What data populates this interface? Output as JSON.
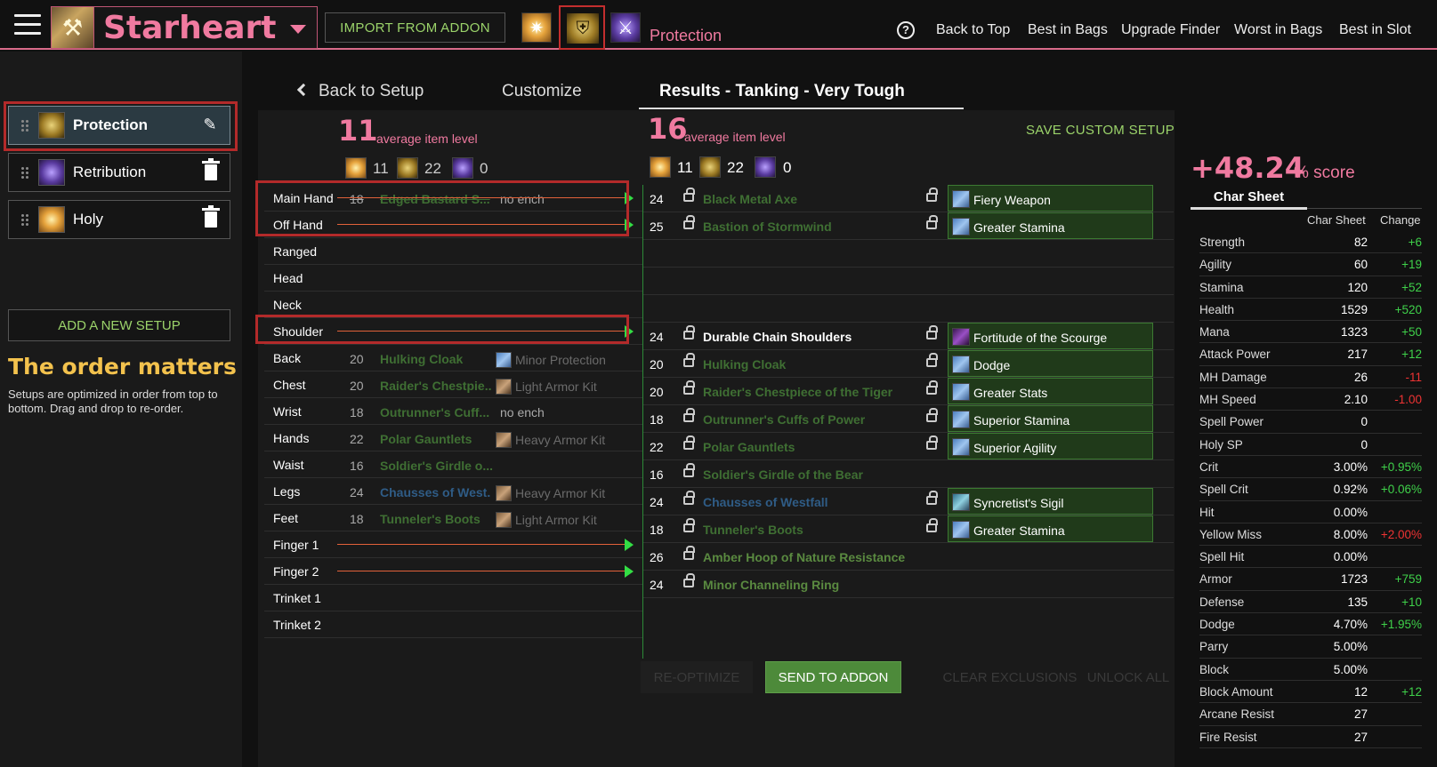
{
  "header": {
    "character_name": "Starheart",
    "import_label": "IMPORT FROM ADDON",
    "spec_label": "Protection",
    "help_glyph": "?",
    "links": [
      "Back to Top",
      "Best in Bags",
      "Upgrade Finder",
      "Worst in Bags",
      "Best in Slot"
    ]
  },
  "sidebar": {
    "setups": [
      {
        "label": "Protection",
        "icon": "protection-icon",
        "action": "edit"
      },
      {
        "label": "Retribution",
        "icon": "retribution-icon",
        "action": "delete"
      },
      {
        "label": "Holy",
        "icon": "holy-icon",
        "action": "delete"
      }
    ],
    "add_label": "ADD A NEW SETUP",
    "order_title": "The order matters",
    "order_text": "Setups are optimized in order from top to bottom. Drag and drop to re-order."
  },
  "tabs": {
    "back": "Back to Setup",
    "customize": "Customize",
    "results": "Results - Tanking - Very Tough"
  },
  "left": {
    "avg_ilvl": "11",
    "avg_label": "average item level",
    "spec_levels": [
      "11",
      "22",
      "0"
    ]
  },
  "right": {
    "avg_ilvl": "16",
    "avg_label": "average item level",
    "spec_levels": [
      "11",
      "22",
      "0"
    ],
    "save_label": "SAVE CUSTOM SETUP"
  },
  "left_rows": [
    {
      "slot": "Main Hand",
      "lvl": "18",
      "item": "Edged Bastard S...",
      "ench": "no ench",
      "arrow": true
    },
    {
      "slot": "Off Hand",
      "lvl": "",
      "item": "",
      "ench": "",
      "arrow": true
    },
    {
      "slot": "Ranged",
      "lvl": "",
      "item": "",
      "ench": ""
    },
    {
      "slot": "Head",
      "lvl": "",
      "item": "",
      "ench": ""
    },
    {
      "slot": "Neck",
      "lvl": "",
      "item": "",
      "ench": ""
    },
    {
      "slot": "Shoulder",
      "lvl": "",
      "item": "",
      "ench": "",
      "arrow": true
    },
    {
      "slot": "Back",
      "lvl": "20",
      "item": "Hulking Cloak",
      "ench": "Minor Protection"
    },
    {
      "slot": "Chest",
      "lvl": "20",
      "item": "Raider's Chestpie...",
      "ench": "Light Armor Kit"
    },
    {
      "slot": "Wrist",
      "lvl": "18",
      "item": "Outrunner's Cuff...",
      "ench": "no ench"
    },
    {
      "slot": "Hands",
      "lvl": "22",
      "item": "Polar Gauntlets",
      "ench": "Heavy Armor Kit"
    },
    {
      "slot": "Waist",
      "lvl": "16",
      "item": "Soldier's Girdle o...",
      "ench": ""
    },
    {
      "slot": "Legs",
      "lvl": "24",
      "item": "Chausses of West...",
      "ench": "Heavy Armor Kit"
    },
    {
      "slot": "Feet",
      "lvl": "18",
      "item": "Tunneler's Boots",
      "ench": "Light Armor Kit"
    },
    {
      "slot": "Finger 1",
      "lvl": "",
      "item": "",
      "ench": "",
      "arrow": true
    },
    {
      "slot": "Finger 2",
      "lvl": "",
      "item": "",
      "ench": "",
      "arrow": true
    },
    {
      "slot": "Trinket 1",
      "lvl": "",
      "item": "",
      "ench": ""
    },
    {
      "slot": "Trinket 2",
      "lvl": "",
      "item": "",
      "ench": ""
    }
  ],
  "right_rows": [
    {
      "lvl": "24",
      "item": "Black Metal Axe",
      "ench": "Fiery Weapon"
    },
    {
      "lvl": "25",
      "item": "Bastion of Stormwind",
      "ench": "Greater Stamina"
    },
    {
      "lvl": "",
      "item": "",
      "ench": ""
    },
    {
      "lvl": "",
      "item": "",
      "ench": ""
    },
    {
      "lvl": "",
      "item": "",
      "ench": ""
    },
    {
      "lvl": "24",
      "item": "Durable Chain Shoulders",
      "ench": "Fortitude of the Scourge"
    },
    {
      "lvl": "20",
      "item": "Hulking Cloak",
      "ench": "Dodge"
    },
    {
      "lvl": "20",
      "item": "Raider's Chestpiece of the Tiger",
      "ench": "Greater Stats"
    },
    {
      "lvl": "18",
      "item": "Outrunner's Cuffs of Power",
      "ench": "Superior Stamina"
    },
    {
      "lvl": "22",
      "item": "Polar Gauntlets",
      "ench": "Superior Agility"
    },
    {
      "lvl": "16",
      "item": "Soldier's Girdle of the Bear",
      "ench": ""
    },
    {
      "lvl": "24",
      "item": "Chausses of Westfall",
      "ench": "Syncretist's Sigil"
    },
    {
      "lvl": "18",
      "item": "Tunneler's Boots",
      "ench": "Greater Stamina"
    },
    {
      "lvl": "26",
      "item": "Amber Hoop of Nature Resistance",
      "ench": ""
    },
    {
      "lvl": "24",
      "item": "Minor Channeling Ring",
      "ench": ""
    }
  ],
  "buttons": {
    "reoptimize": "RE-OPTIMIZE",
    "send": "SEND TO ADDON",
    "clear": "CLEAR EXCLUSIONS",
    "unlock": "UNLOCK ALL"
  },
  "charsheet": {
    "score": "+48.24",
    "score_suffix": "% score",
    "tab": "Char Sheet",
    "col_sheet": "Char Sheet",
    "col_change": "Change",
    "stats": [
      {
        "name": "Strength",
        "value": "82",
        "change": "+6"
      },
      {
        "name": "Agility",
        "value": "60",
        "change": "+19"
      },
      {
        "name": "Stamina",
        "value": "120",
        "change": "+52"
      },
      {
        "name": "Health",
        "value": "1529",
        "change": "+520"
      },
      {
        "name": "Mana",
        "value": "1323",
        "change": "+50"
      },
      {
        "name": "Attack Power",
        "value": "217",
        "change": "+12"
      },
      {
        "name": "MH Damage",
        "value": "26",
        "change": "-11"
      },
      {
        "name": "MH Speed",
        "value": "2.10",
        "change": "-1.00"
      },
      {
        "name": "Spell Power",
        "value": "0",
        "change": ""
      },
      {
        "name": "Holy SP",
        "value": "0",
        "change": ""
      },
      {
        "name": "Crit",
        "value": "3.00%",
        "change": "+0.95%"
      },
      {
        "name": "Spell Crit",
        "value": "0.92%",
        "change": "+0.06%"
      },
      {
        "name": "Hit",
        "value": "0.00%",
        "change": ""
      },
      {
        "name": "Yellow Miss",
        "value": "8.00%",
        "change": "+2.00%"
      },
      {
        "name": "Spell Hit",
        "value": "0.00%",
        "change": ""
      },
      {
        "name": "Armor",
        "value": "1723",
        "change": "+759"
      },
      {
        "name": "Defense",
        "value": "135",
        "change": "+10"
      },
      {
        "name": "Dodge",
        "value": "4.70%",
        "change": "+1.95%"
      },
      {
        "name": "Parry",
        "value": "5.00%",
        "change": ""
      },
      {
        "name": "Block",
        "value": "5.00%",
        "change": ""
      },
      {
        "name": "Block Amount",
        "value": "12",
        "change": "+12"
      },
      {
        "name": "Arcane Resist",
        "value": "27",
        "change": ""
      },
      {
        "name": "Fire Resist",
        "value": "27",
        "change": ""
      }
    ]
  },
  "colors": {
    "accent_pink": "#f07aa0",
    "accent_green": "#9bd36a",
    "gold": "#f3c24d",
    "positive": "#3fd14a",
    "negative": "#ee3333"
  }
}
